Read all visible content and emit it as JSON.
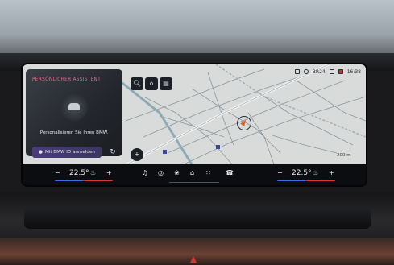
{
  "status_bar": {
    "radio": "BR24",
    "time": "16:38"
  },
  "assistant_card": {
    "title": "PERSÖNLICHER ASSISTENT",
    "text": "Personalisieren Sie Ihren BMW.",
    "login_button": "Mit BMW ID anmelden"
  },
  "map": {
    "scale": "200 m",
    "tools": {
      "search_icon": "search-icon",
      "destination_icon": "destination-icon",
      "book_icon": "address-book-icon",
      "add_icon": "add-icon"
    }
  },
  "climate": {
    "left_temp": "22.5°",
    "right_temp": "22.5°",
    "minus": "−",
    "plus": "+"
  },
  "colors": {
    "accent_pink": "#e36a8d",
    "temp_cold": "#3d6fe0",
    "temp_hot": "#d8363a",
    "position_arrow": "#e0622c"
  }
}
